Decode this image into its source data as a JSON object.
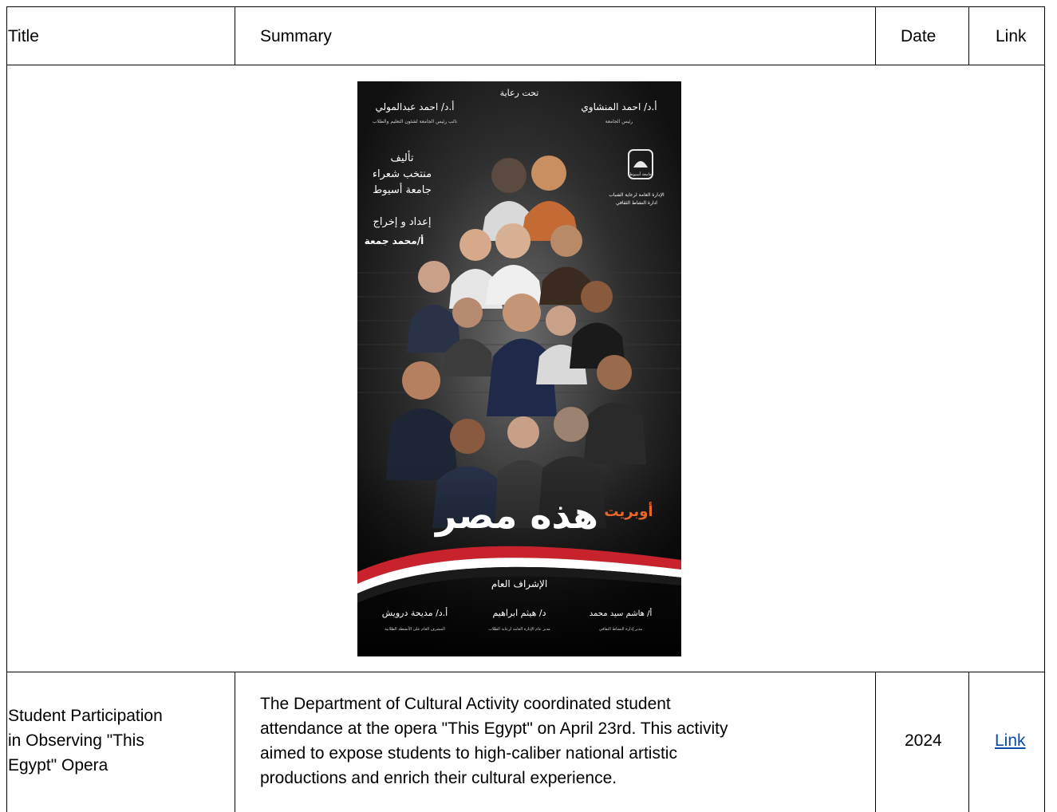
{
  "table": {
    "headers": {
      "title": "Title",
      "summary": "Summary",
      "date": "Date",
      "link": "Link"
    },
    "poster": {
      "top_line": "تحت رعاية",
      "left_name": "أ.د/ احمد عبدالمولي",
      "left_role": "نائب رئيس الجامعة لشئون التعليم والطلاب",
      "right_name": "أ.د/ احمد المنشاوي",
      "right_role": "رئيس الجامعة",
      "authorship_heading": "تأليف",
      "authorship_1": "منتخب شعراء",
      "authorship_2": "جامعة أسيوط",
      "directing_heading": "إعداد و إخراج",
      "director": "أ/محمد جمعة",
      "seal_text": "جامعة أسيوط",
      "dept_1": "الإدارة العامة لرعاية الشباب",
      "dept_2": "ادارة النشاط الثقافي",
      "prefix": "أوبريت",
      "title": "هذه مصر",
      "supervision": "الإشراف العام",
      "sup1_name": "أ.د/ مديحة درويش",
      "sup1_role": "المشرف العام على الأنشطة الطلابية",
      "sup2_name": "د/ هيثم ابراهيم",
      "sup2_role": "مدير عام الإدارة العامة لرعاية الطلاب",
      "sup3_name": "أ/ هاشم سيد محمد",
      "sup3_role": "مدير إدارة النشاط الثقافي",
      "colors": {
        "background": "#121212",
        "accent_orange": "#e8662a",
        "flag_red": "#c8232c",
        "title_white": "#ffffff"
      }
    },
    "row": {
      "title_line1": "Student Participation",
      "title_line2": "in Observing \"This",
      "title_line3": "Egypt\" Opera",
      "summary_line1": "The Department of Cultural Activity coordinated student",
      "summary_line2": "attendance at the opera \"This Egypt\" on April 23rd. This activity",
      "summary_line3": "aimed to expose students to high-caliber national artistic",
      "summary_line4": "productions and enrich their cultural experience.",
      "date": "2024",
      "link": "Link"
    }
  }
}
